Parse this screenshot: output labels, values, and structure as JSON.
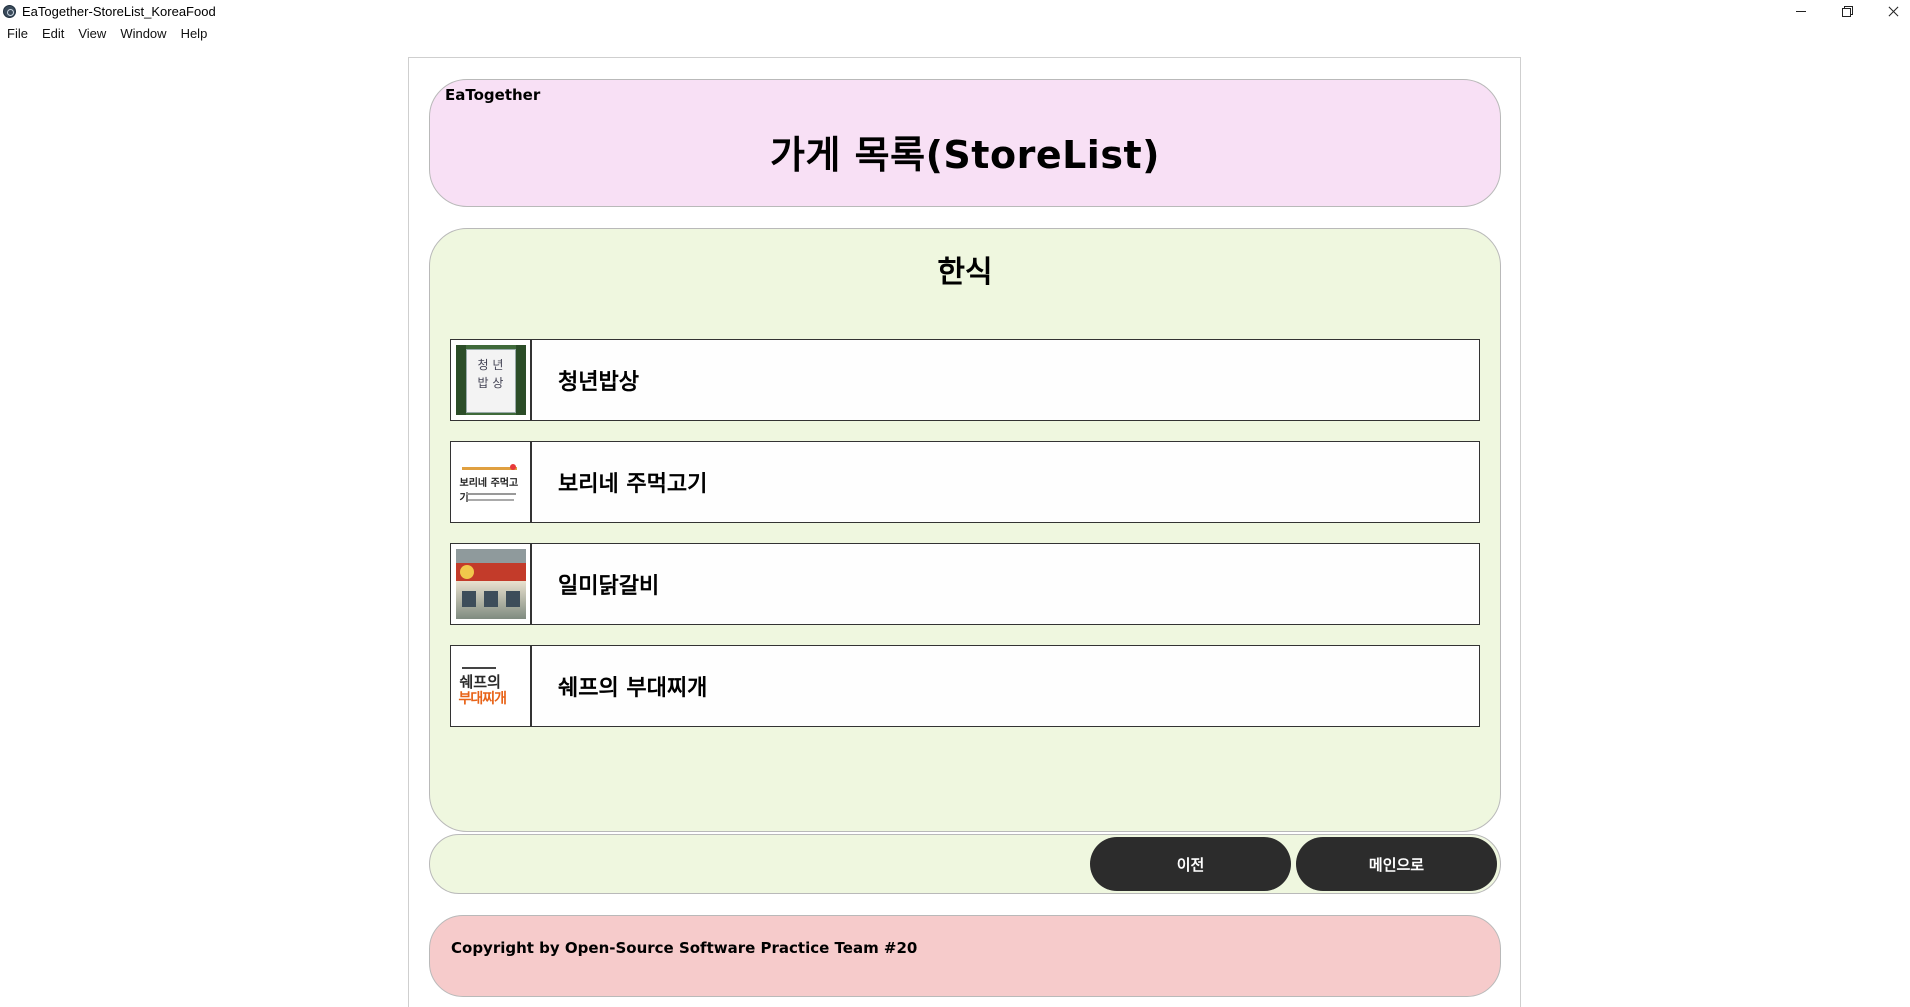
{
  "window": {
    "title": "EaTogether-StoreList_KoreaFood",
    "menu": [
      "File",
      "Edit",
      "View",
      "Window",
      "Help"
    ]
  },
  "header": {
    "brand": "EaTogether",
    "title": "가게 목록(StoreList)"
  },
  "content": {
    "category": "한식",
    "stores": [
      {
        "name": "청년밥상",
        "thumbnail": "store-photo-sign",
        "thumb_text": [
          "청 년",
          "밥 상"
        ]
      },
      {
        "name": "보리네 주먹고기",
        "thumbnail": "store-photo-card",
        "thumb_text": "보리네 주먹고기"
      },
      {
        "name": "일미닭갈비",
        "thumbnail": "store-photo-front"
      },
      {
        "name": "쉐프의 부대찌개",
        "thumbnail": "store-photo-logo",
        "thumb_text": [
          "쉐프의",
          "부대찌개"
        ]
      }
    ]
  },
  "nav": {
    "prev_label": "이전",
    "main_label": "메인으로"
  },
  "footer": {
    "copyright": "Copyright by Open-Source Software Practice Team #20"
  }
}
